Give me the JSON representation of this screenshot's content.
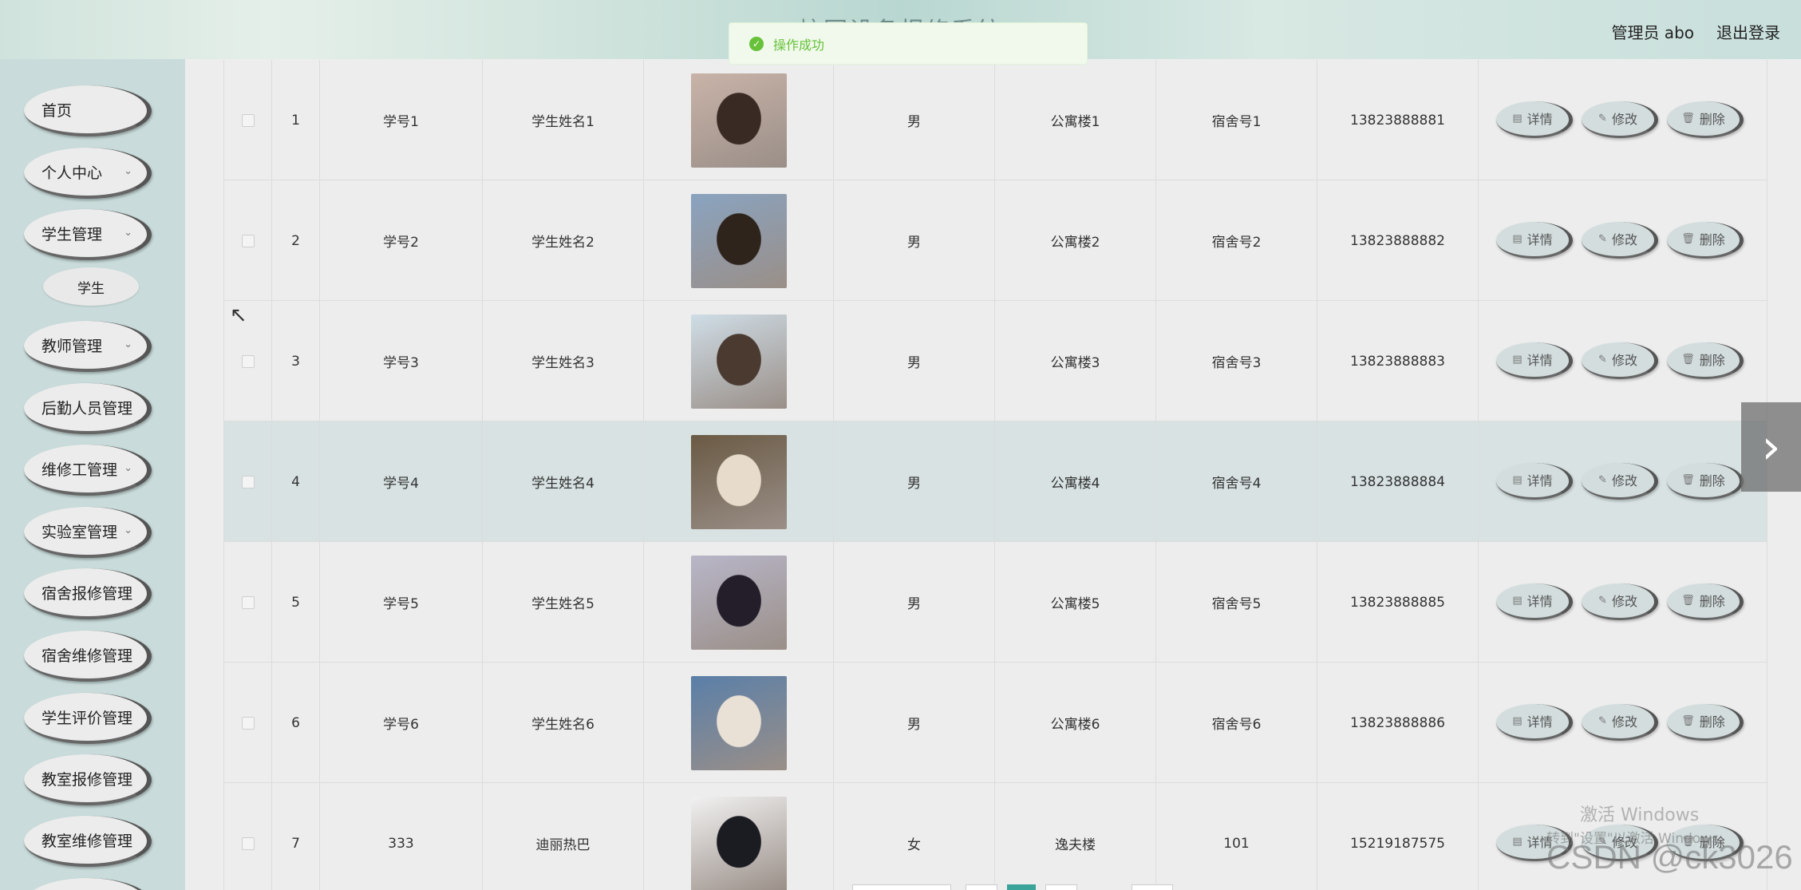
{
  "header": {
    "title": "校园设备报修系统",
    "admin_label": "管理员 abo",
    "logout_label": "退出登录"
  },
  "toast": {
    "message": "操作成功",
    "icon": "check-circle-icon"
  },
  "sidebar": {
    "items": [
      {
        "label": "首页",
        "has_chevron": false
      },
      {
        "label": "个人中心",
        "has_chevron": true
      },
      {
        "label": "学生管理",
        "has_chevron": true
      },
      {
        "label": "学生",
        "sub": true
      },
      {
        "label": "教师管理",
        "has_chevron": true
      },
      {
        "label": "后勤人员管理",
        "has_chevron": false
      },
      {
        "label": "维修工管理",
        "has_chevron": true
      },
      {
        "label": "实验室管理",
        "has_chevron": true
      },
      {
        "label": "宿舍报修管理",
        "has_chevron": false
      },
      {
        "label": "宿舍维修管理",
        "has_chevron": false
      },
      {
        "label": "学生评价管理",
        "has_chevron": false
      },
      {
        "label": "教室报修管理",
        "has_chevron": false
      },
      {
        "label": "教室维修管理",
        "has_chevron": false
      }
    ]
  },
  "actions": {
    "detail": "详情",
    "edit": "修改",
    "delete": "删除"
  },
  "rows": [
    {
      "index": "1",
      "student_no": "学号1",
      "name": "学生姓名1",
      "gender": "男",
      "building": "公寓楼1",
      "room": "宿舍号1",
      "phone": "13823888881",
      "photo_bg": [
        "#c9b3a8",
        "#3a2a24"
      ]
    },
    {
      "index": "2",
      "student_no": "学号2",
      "name": "学生姓名2",
      "gender": "男",
      "building": "公寓楼2",
      "room": "宿舍号2",
      "phone": "13823888882",
      "photo_bg": [
        "#8aa3c0",
        "#2e241c"
      ]
    },
    {
      "index": "3",
      "student_no": "学号3",
      "name": "学生姓名3",
      "gender": "男",
      "building": "公寓楼3",
      "room": "宿舍号3",
      "phone": "13823888883",
      "photo_bg": [
        "#cfdde6",
        "#4a3a30"
      ]
    },
    {
      "index": "4",
      "student_no": "学号4",
      "name": "学生姓名4",
      "gender": "男",
      "building": "公寓楼4",
      "room": "宿舍号4",
      "phone": "13823888884",
      "photo_bg": [
        "#6a5a44",
        "#e7dccb"
      ]
    },
    {
      "index": "5",
      "student_no": "学号5",
      "name": "学生姓名5",
      "gender": "男",
      "building": "公寓楼5",
      "room": "宿舍号5",
      "phone": "13823888885",
      "photo_bg": [
        "#b8b6c8",
        "#231e2a"
      ]
    },
    {
      "index": "6",
      "student_no": "学号6",
      "name": "学生姓名6",
      "gender": "男",
      "building": "公寓楼6",
      "room": "宿舍号6",
      "phone": "13823888886",
      "photo_bg": [
        "#5a7fa8",
        "#e9e0d6"
      ]
    },
    {
      "index": "7",
      "student_no": "333",
      "name": "迪丽热巴",
      "gender": "女",
      "building": "逸夫楼",
      "room": "101",
      "phone": "15219187575",
      "photo_bg": [
        "#f1f1f1",
        "#1b1b22"
      ]
    }
  ],
  "highlighted_row": 4,
  "next_arrow_icon": "chevron-right-icon",
  "watermark": {
    "line1": "激活 Windows",
    "line2": "转到\"设置\"以激活 Windows。",
    "line3": "CSDN @ck3026"
  },
  "colors": {
    "accent": "#3aa39a",
    "toast_text": "#67c23a",
    "sidebar_bg": "#c9dcdb"
  }
}
